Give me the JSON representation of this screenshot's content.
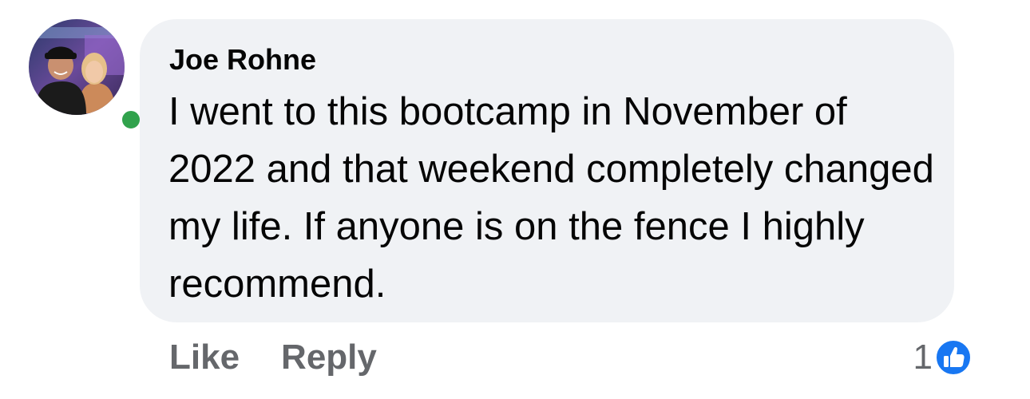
{
  "comment": {
    "author": "Joe Rohne",
    "text": "I went to this bootcamp in November of 2022 and that weekend completely changed my life. If anyone is on the fence I highly recommend.",
    "online": true,
    "actions": {
      "like_label": "Like",
      "reply_label": "Reply"
    },
    "reactions": {
      "count": "1",
      "icon": "like-icon"
    }
  },
  "colors": {
    "bubble": "#f0f2f5",
    "text": "#050505",
    "secondary": "#65676b",
    "presence": "#31a24c",
    "like_blue": "#1877f2"
  }
}
